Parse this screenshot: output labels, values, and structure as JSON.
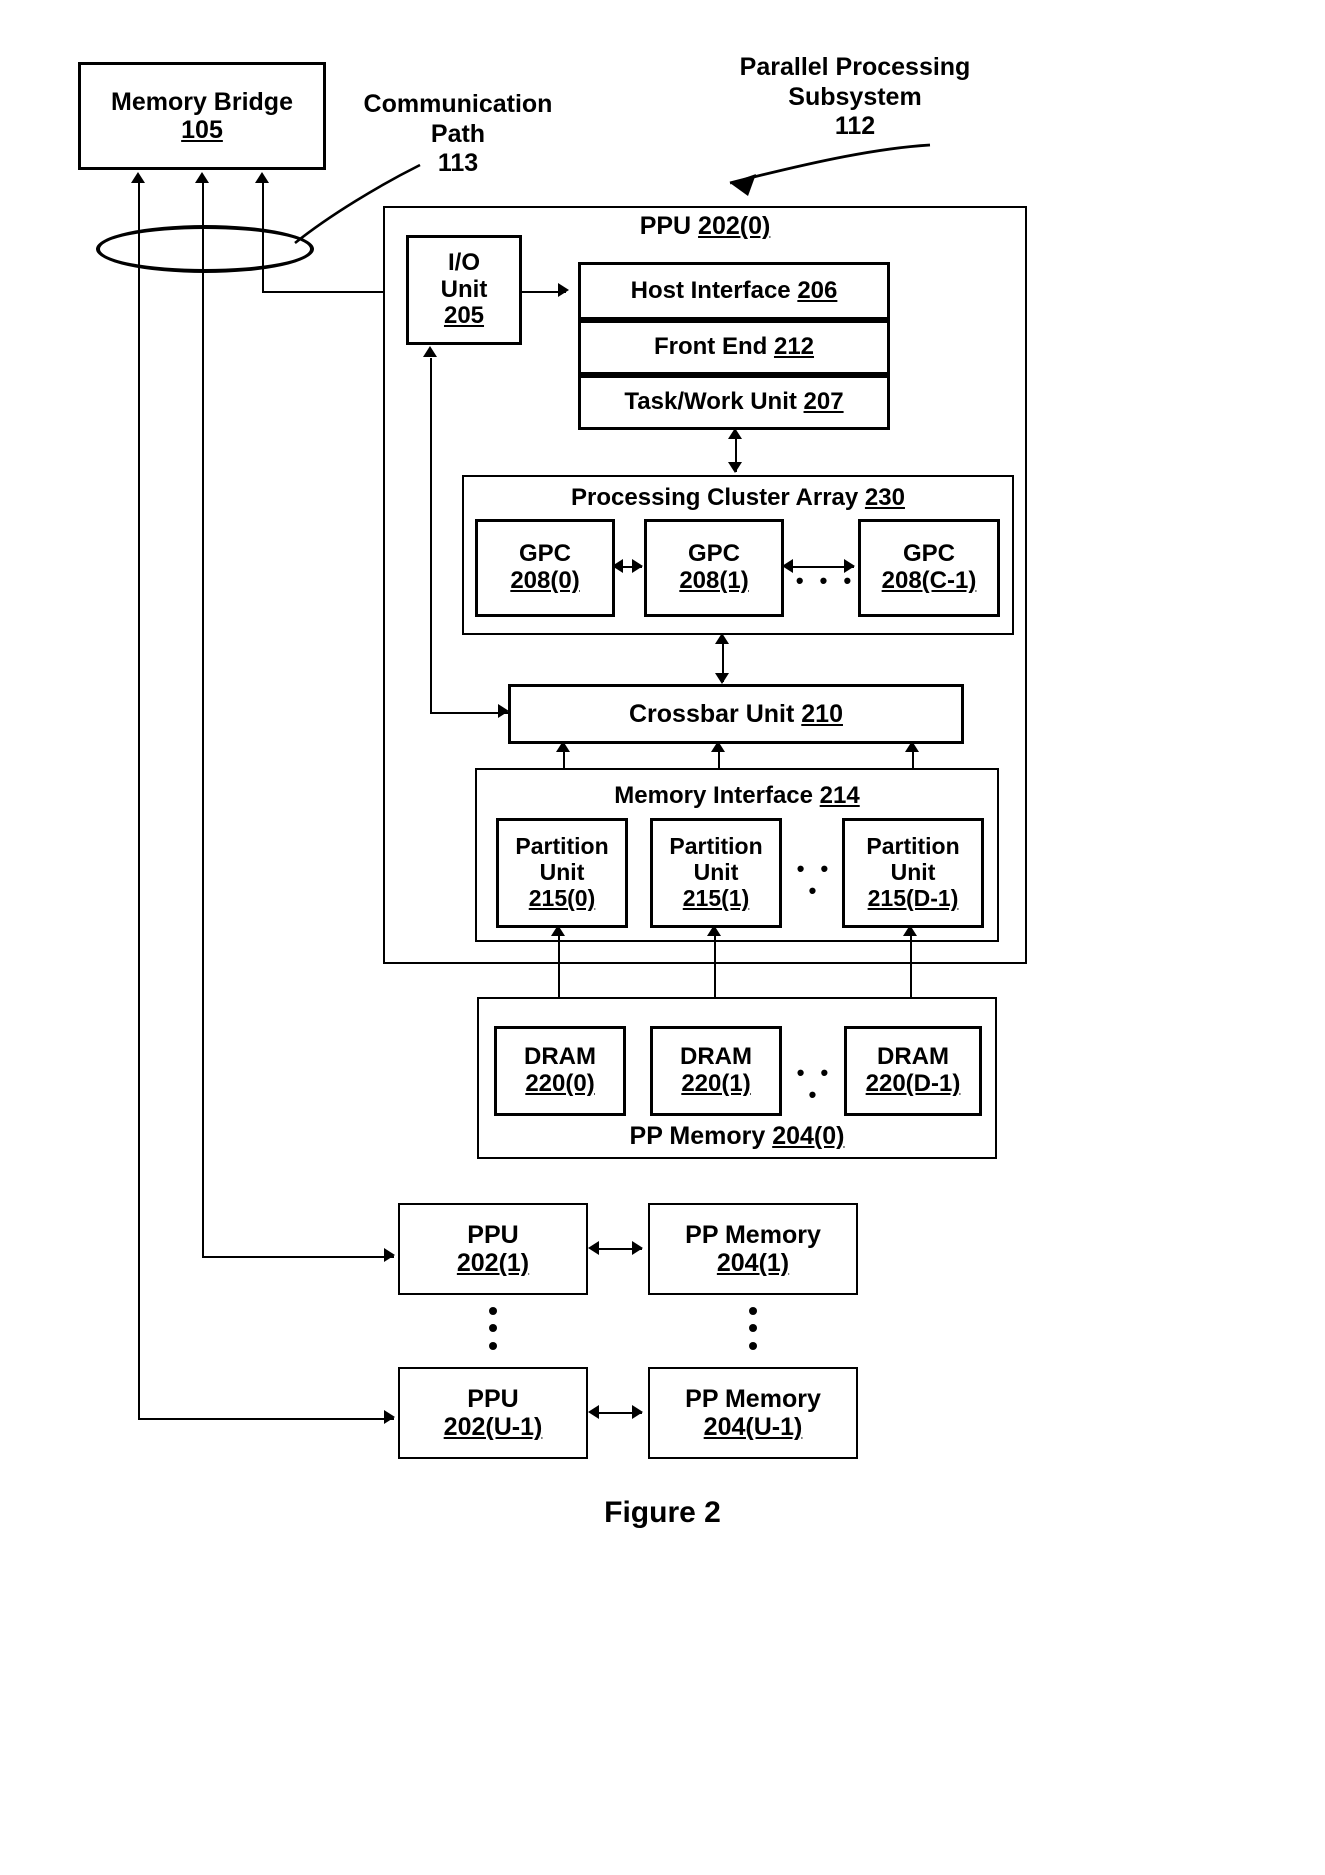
{
  "figure": {
    "caption": "Figure 2"
  },
  "labels": {
    "communication_path": "Communication\nPath\n113",
    "parallel_processing_subsystem": "Parallel Processing\nSubsystem\n112"
  },
  "memory_bridge": {
    "name": "Memory Bridge",
    "ref": "105"
  },
  "ppu0": {
    "title_prefix": "PPU ",
    "title_ref": "202(0)",
    "io_unit": {
      "line1": "I/O",
      "line2": "Unit",
      "ref": "205"
    },
    "host_interface": {
      "label": "Host Interface ",
      "ref": "206"
    },
    "front_end": {
      "label": "Front End ",
      "ref": "212"
    },
    "task_work_unit": {
      "label": "Task/Work Unit ",
      "ref": "207"
    },
    "processing_cluster_array": {
      "label": "Processing Cluster Array ",
      "ref": "230",
      "gpcs": [
        {
          "name": "GPC",
          "ref": "208(0)"
        },
        {
          "name": "GPC",
          "ref": "208(1)"
        },
        {
          "name": "GPC",
          "ref": "208(C-1)"
        }
      ],
      "ellipsis": "• • •"
    },
    "crossbar_unit": {
      "label": "Crossbar Unit ",
      "ref": "210"
    },
    "memory_interface": {
      "label": "Memory Interface ",
      "ref": "214",
      "partition_units": [
        {
          "line1": "Partition",
          "line2": "Unit",
          "ref": "215(0)"
        },
        {
          "line1": "Partition",
          "line2": "Unit",
          "ref": "215(1)"
        },
        {
          "line1": "Partition",
          "line2": "Unit",
          "ref": "215(D-1)"
        }
      ],
      "ellipsis": "• • •"
    }
  },
  "pp_memory0": {
    "label": "PP Memory ",
    "ref": "204(0)",
    "drams": [
      {
        "name": "DRAM",
        "ref": "220(0)"
      },
      {
        "name": "DRAM",
        "ref": "220(1)"
      },
      {
        "name": "DRAM",
        "ref": "220(D-1)"
      }
    ],
    "ellipsis": "• • •"
  },
  "additional_units": {
    "vertical_ellipsis": "•\n•\n•",
    "rows": [
      {
        "ppu": {
          "name": "PPU",
          "ref": "202(1)"
        },
        "memory": {
          "name": "PP Memory",
          "ref": "204(1)"
        }
      },
      {
        "ppu": {
          "name": "PPU",
          "ref": "202(U-1)"
        },
        "memory": {
          "name": "PP Memory",
          "ref": "204(U-1)"
        }
      }
    ]
  }
}
